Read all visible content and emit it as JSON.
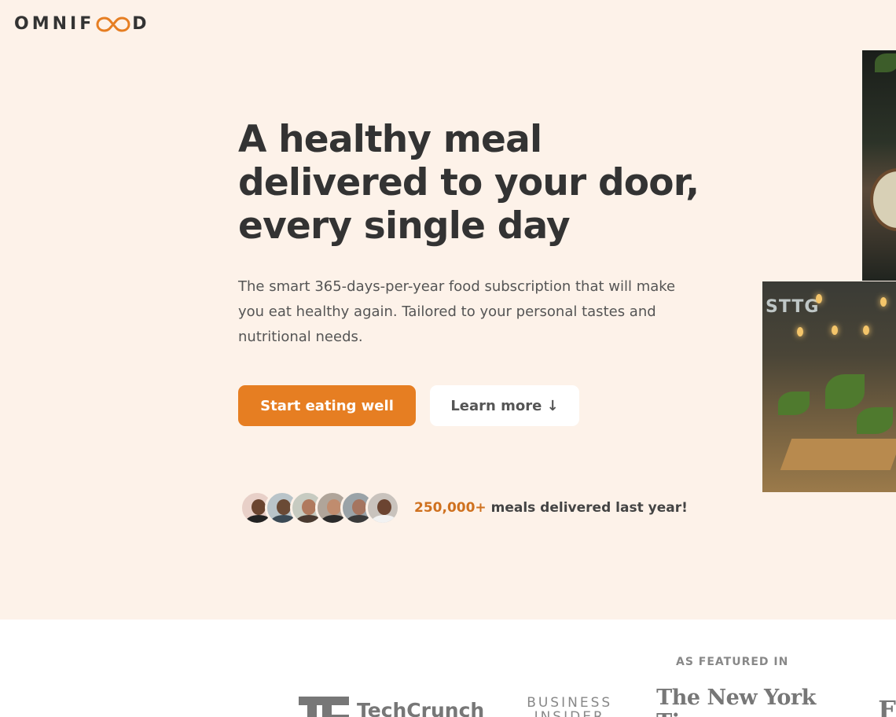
{
  "header": {
    "logo_left": "OMNIF",
    "logo_right": "D"
  },
  "hero": {
    "headline_line1": "A healthy meal",
    "headline_line2": "delivered to your door,",
    "headline_line3": "every single day",
    "description": "The smart 365-days-per-year food subscription that will make you eat healthy again. Tailored to your personal tastes and nutritional needs.",
    "primary_button": "Start eating well",
    "secondary_button": "Learn more ↓",
    "delivered_number": "250,000+",
    "delivered_text": " meals delivered last year!",
    "image_sign": "STTG"
  },
  "featured": {
    "title": "AS FEATURED IN",
    "logos": {
      "techcrunch": "TechCrunch",
      "business_insider_line1": "BUSINESS",
      "business_insider_line2": "INSIDER",
      "nyt": "The New York Times",
      "forbes": "F"
    }
  },
  "colors": {
    "background": "#fdf2e9",
    "accent": "#e67e22",
    "accent_dark": "#cf711f",
    "text": "#333333"
  }
}
